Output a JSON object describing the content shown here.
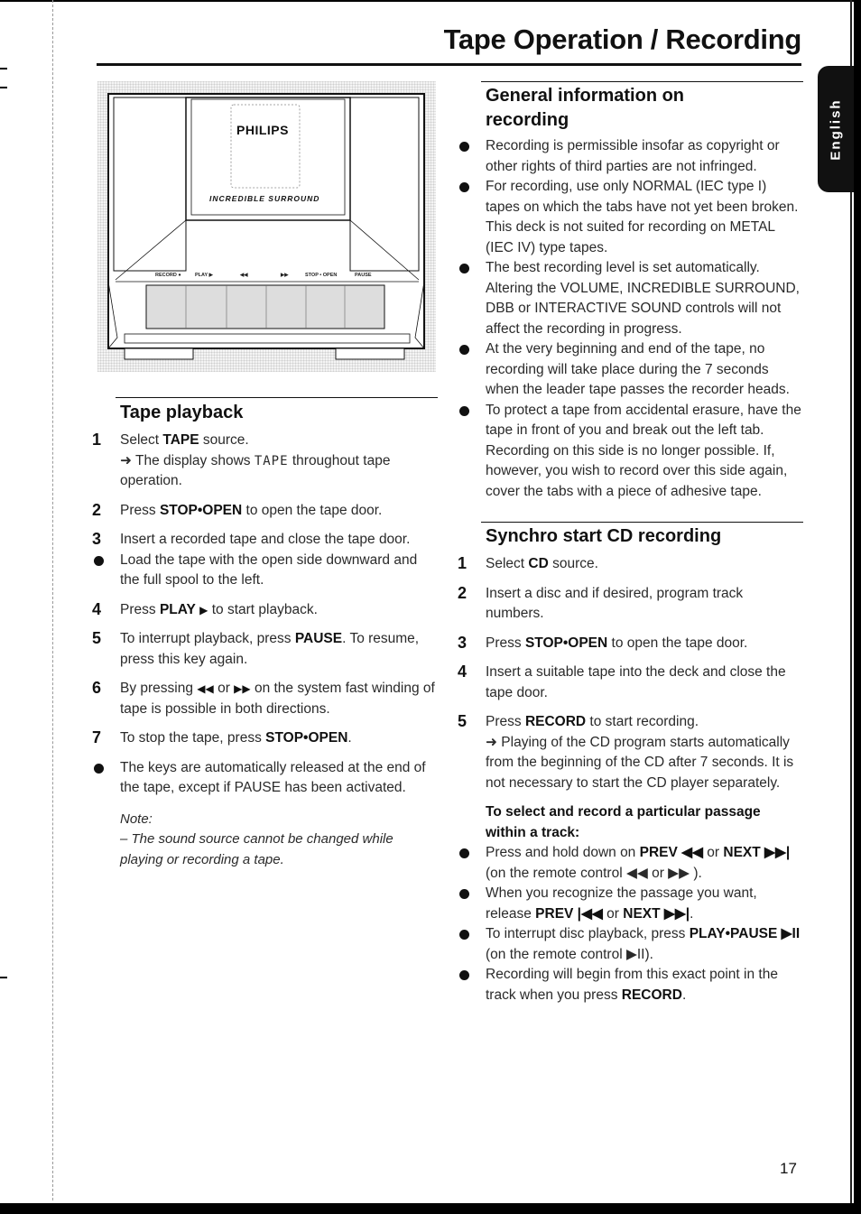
{
  "page": {
    "title": "Tape Operation / Recording",
    "language_tab": "English",
    "page_number": "17"
  },
  "illustration": {
    "brand": "PHILIPS",
    "feature": "INCREDIBLE SURROUND",
    "keys": [
      "RECORD ●",
      "PLAY ▶",
      "◀◀",
      "▶▶",
      "STOP • OPEN",
      "PAUSE"
    ]
  },
  "tape_playback": {
    "title": "Tape playback",
    "steps": [
      {
        "num": "1",
        "pre": "Select ",
        "bold": "TAPE",
        "post": " source.",
        "result_pre": "➜ The display shows ",
        "result_lcd": "TAPE",
        "result_post": " throughout tape operation."
      },
      {
        "num": "2",
        "pre": "Press ",
        "bold": "STOP•OPEN",
        "post": " to open the tape door."
      },
      {
        "num": "3",
        "text": "Insert a recorded tape and close the tape door."
      },
      {
        "bullet": true,
        "text": "Load the tape with the open side downward and the full spool to the left."
      },
      {
        "num": "4",
        "pre": "Press ",
        "bold": "PLAY",
        "symbol": "▶",
        "post": " to start playback."
      },
      {
        "num": "5",
        "pre": "To interrupt playback, press ",
        "bold": "PAUSE",
        "post": ". To resume, press this key again."
      },
      {
        "num": "6",
        "pre": "By pressing ",
        "sym1": "◀◀",
        "mid": " or ",
        "sym2": "▶▶",
        "post": " on the system fast winding of tape is possible in both directions."
      },
      {
        "num": "7",
        "pre": "To stop the tape, press ",
        "bold": "STOP•OPEN",
        "post": "."
      },
      {
        "bullet": true,
        "text": "The keys are automatically released at the end of the tape, except if PAUSE has been activated."
      }
    ],
    "note_label": "Note:",
    "note_text": "– The sound source cannot be changed while playing or recording a tape."
  },
  "general_info": {
    "title": "General information on recording",
    "bullets": [
      "Recording is permissible insofar as copyright or other rights of third parties are not infringed.",
      "For recording, use only NORMAL (IEC type I) tapes on which the tabs have not yet been broken. This deck is not suited for recording on METAL (IEC IV) type tapes.",
      "The best recording level is set automatically. Altering the VOLUME, INCREDIBLE SURROUND, DBB or INTERACTIVE SOUND controls will not affect the recording in progress.",
      "At the very beginning and end of the tape, no recording will take place during the 7 seconds when the leader tape passes the recorder heads.",
      "To protect a tape from accidental erasure, have the tape in front of you and break out the left tab. Recording on this side is no longer possible. If, however, you wish to record over this side again, cover the tabs with a piece of adhesive tape."
    ]
  },
  "synchro": {
    "title": "Synchro start CD recording",
    "steps": [
      {
        "num": "1",
        "pre": "Select ",
        "bold": "CD",
        "post": " source."
      },
      {
        "num": "2",
        "text": "Insert a disc and if desired, program track numbers."
      },
      {
        "num": "3",
        "pre": "Press ",
        "bold": "STOP•OPEN",
        "post": " to open the tape door."
      },
      {
        "num": "4",
        "text": "Insert a suitable tape into the deck and close the tape door."
      },
      {
        "num": "5",
        "pre": "Press ",
        "bold": "RECORD",
        "post": " to start recording.",
        "result": "➜ Playing of the CD program starts automatically from the beginning of the CD after 7 seconds. It is not necessary to start the CD player separately."
      }
    ],
    "passage_heading": "To select and record a particular passage within a track:",
    "passage_bullets": [
      {
        "pre": "Press and hold down on ",
        "b1": "PREV ◀◀",
        "mid": " or ",
        "b2": "NEXT ▶▶|",
        "post": " (on the remote control ◀◀ or ▶▶ )."
      },
      {
        "pre": "When you recognize the passage you want, release ",
        "b1": "PREV |◀◀",
        "mid": " or ",
        "b2": "NEXT ▶▶|",
        "post": "."
      },
      {
        "pre": "To interrupt disc playback, press ",
        "b1": "PLAY•PAUSE ▶II",
        "mid": "",
        "b2": "",
        "post": " (on the remote control ▶II)."
      },
      {
        "pre": "Recording will begin from this exact point in the track when you press ",
        "b1": "RECORD",
        "mid": "",
        "b2": "",
        "post": "."
      }
    ]
  }
}
